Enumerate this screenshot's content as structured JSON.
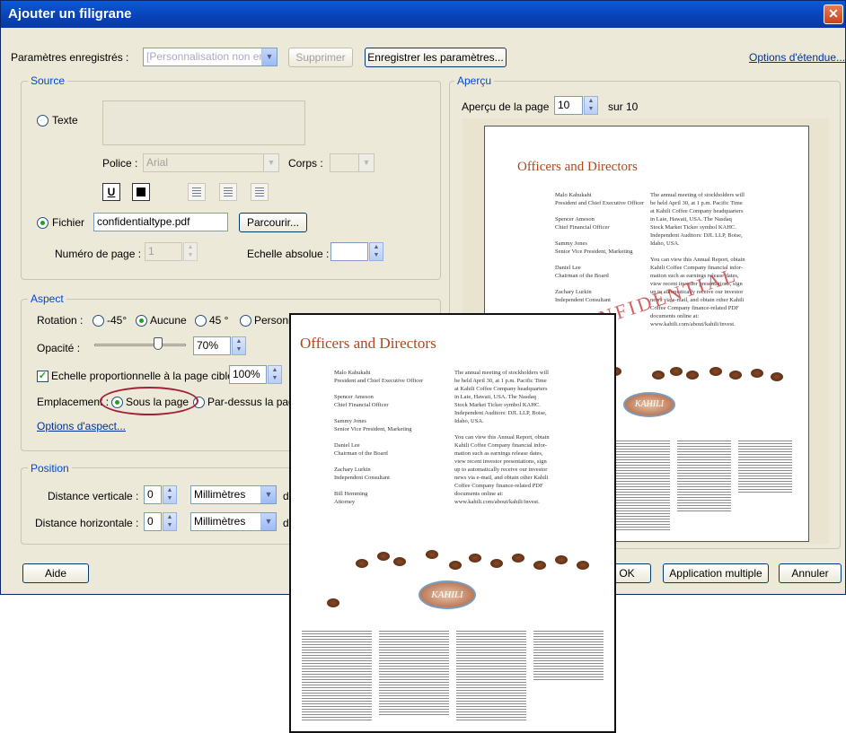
{
  "window": {
    "title": "Ajouter un filigrane",
    "close_glyph": "✕"
  },
  "header": {
    "saved_settings_label": "Paramètres enregistrés :",
    "saved_settings_value": "[Personnalisation non enregistrée]",
    "delete_button": "Supprimer",
    "save_button": "Enregistrer les paramètres...",
    "range_options_link": "Options d'étendue..."
  },
  "source": {
    "title": "Source",
    "text_option": "Texte",
    "font_label": "Police :",
    "font_value": "Arial",
    "size_label": "Corps :",
    "size_value": "",
    "file_option": "Fichier",
    "file_value": "confidentialtype.pdf",
    "browse_button": "Parcourir...",
    "page_number_label": "Numéro de page :",
    "page_number_value": "1",
    "absolute_scale_label": "Echelle absolue :",
    "absolute_scale_value": "",
    "underline_glyph": "U"
  },
  "aspect": {
    "title": "Aspect",
    "rotation_label": "Rotation :",
    "rotation_options": [
      "-45°",
      "Aucune",
      "45 °",
      "Personnalisée"
    ],
    "opacity_label": "Opacité :",
    "opacity_value": "70%",
    "opacity_fraction": 0.7,
    "scale_relative_label": "Echelle proportionnelle à la page cible",
    "scale_relative_value": "100%",
    "placement_label": "Emplacement :",
    "behind_page": "Sous la page",
    "above_page": "Par-dessus la page",
    "aspect_options_link": "Options d'aspect..."
  },
  "position": {
    "title": "Position",
    "vertical_label": "Distance verticale :",
    "vertical_value": "0",
    "vertical_unit": "Millimètres",
    "horizontal_label": "Distance horizontale :",
    "horizontal_value": "0",
    "horizontal_unit": "Millimètres",
    "from_label_partial": "d"
  },
  "preview": {
    "title": "Aperçu",
    "page_label": "Aperçu de la page",
    "page_value": "10",
    "page_total": "sur 10",
    "doc_title": "Officers and Directors",
    "watermark_text": "CONFIDENTIAL",
    "logo_text": "KAHILI",
    "names": "Malo Kahukahi\nPresident and Chief Executive Officer\n\nSpencer Ameson\nChief Financial Officer\n\nSammy Jones\nSenior Vice President, Marketing\n\nDaniel Lee\nChairman of the Board\n\nZachary Lurkin\nIndependent Consultant",
    "names_large": "Malo Kahukahi\nPresident and Chief Executive Officer\n\nSpencer Ameson\nChief Financial Officer\n\nSammy Jones\nSenior Vice President, Marketing\n\nDaniel Lee\nChairman of the Board\n\nZachary Lurkin\nIndependent Consultant\n\nBill Hemming\nAttorney",
    "meeting": "The annual meeting of stockholders will\nbe held April 30, at 1 p.m. Pacific Time\nat Kahili Coffee Company headquarters\nin Laie, Hawaii, USA. The Nasdaq\nStock Market Ticker symbol KAHC.\nIndependent Auditors: DJL LLP, Boise,\nIdaho, USA.\n\nYou can view this Annual Report, obtain\nKahili Coffee Company financial infor-\nmation such as earnings release dates,\nview recent investor presentations, sign\nup to automatically receive our investor\nnews via e-mail, and obtain other Kahili\nCoffee Company finance-related PDF\ndocuments online at:\nwww.kahili.com/about/kahili/invest."
  },
  "footer": {
    "help_button": "Aide",
    "ok_button": "OK",
    "apply_multiple_button": "Application multiple",
    "cancel_button": "Annuler"
  }
}
